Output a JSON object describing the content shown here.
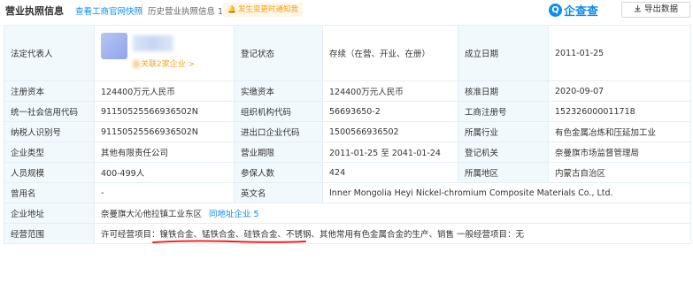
{
  "header": {
    "title": "营业执照信息",
    "gov_link": "查看工商官网快照",
    "history": "历史营业执照信息",
    "history_count": "1",
    "alert_badge": "发生变更时通知我",
    "logo_text": "企查查",
    "export_label": "导出数据"
  },
  "colors": {
    "accent_blue": "#128bed",
    "label_bg": "#f2f9fc",
    "border": "#e4eef6",
    "orange": "#f5a623",
    "underline_red": "#e6231f"
  },
  "icons": [
    "bell-icon",
    "qcc-logo-icon",
    "download-icon"
  ],
  "table": {
    "legal_rep": {
      "label": "法定代表人",
      "name": "",
      "link_suffix": "关联2家企业 >"
    },
    "rows": [
      {
        "cells": [
          {
            "label": "登记状态",
            "value": "存续（在营、开业、在册）"
          },
          {
            "label": "成立日期",
            "value": "2011-01-25"
          }
        ]
      },
      {
        "cells": [
          {
            "label": "注册资本",
            "value": "124400万元人民币"
          },
          {
            "label": "实缴资本",
            "value": "124400万元人民币"
          },
          {
            "label": "核准日期",
            "value": "2020-09-07"
          }
        ]
      },
      {
        "cells": [
          {
            "label": "统一社会信用代码",
            "value": "91150525566936502N"
          },
          {
            "label": "组织机构代码",
            "value": "56693650-2"
          },
          {
            "label": "工商注册号",
            "value": "152326000011718"
          }
        ]
      },
      {
        "cells": [
          {
            "label": "纳税人识别号",
            "value": "91150525566936502N"
          },
          {
            "label": "进出口企业代码",
            "value": "1500566936502"
          },
          {
            "label": "所属行业",
            "value": "有色金属冶炼和压延加工业"
          }
        ]
      },
      {
        "cells": [
          {
            "label": "企业类型",
            "value": "其他有限责任公司"
          },
          {
            "label": "营业期限",
            "value": "2011-01-25 至 2041-01-24"
          },
          {
            "label": "登记机关",
            "value": "奈曼旗市场监督管理局"
          }
        ]
      },
      {
        "cells": [
          {
            "label": "人员规模",
            "value": "400-499人"
          },
          {
            "label": "参保人数",
            "value": "424"
          },
          {
            "label": "所属地区",
            "value": "内蒙古自治区"
          }
        ]
      },
      {
        "cells": [
          {
            "label": "曾用名",
            "value": "-"
          },
          {
            "label": "英文名",
            "value": "Inner Mongolia Heyi Nickel-chromium Composite Materials Co., Ltd."
          }
        ]
      }
    ],
    "address": {
      "label": "企业地址",
      "value": "奈曼旗大沁他拉镇工业东区",
      "nearby_link": "同地址企业 5"
    },
    "scope": {
      "label": "经营范围",
      "value": "许可经营项目：镍铁合金、锰铁合金、硅铁合金、不锈钢、其他常用有色金属合金的生产、销售 一般经营项目：无"
    }
  }
}
